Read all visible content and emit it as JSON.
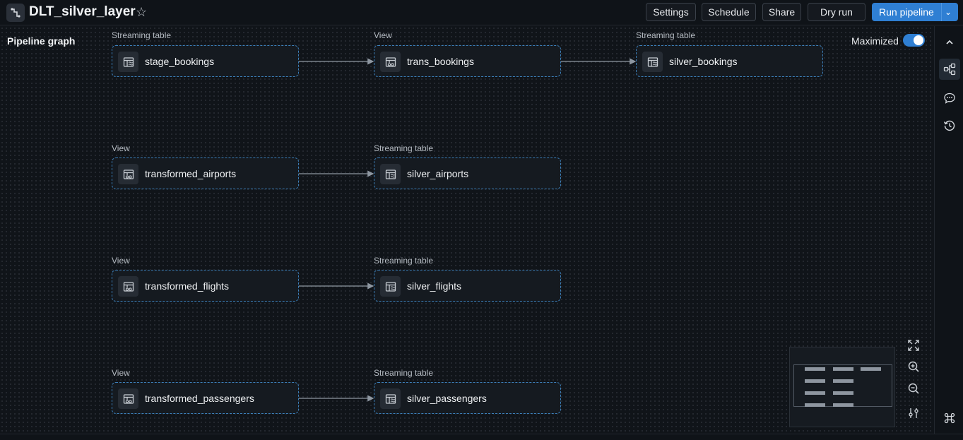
{
  "header": {
    "title": "DLT_silver_layer",
    "buttons": {
      "settings": "Settings",
      "schedule": "Schedule",
      "share": "Share",
      "dry_run": "Dry run",
      "run_pipeline": "Run pipeline"
    }
  },
  "graph": {
    "title": "Pipeline graph",
    "maximized_label": "Maximized",
    "maximized": true,
    "nodes": {
      "stage_bookings": {
        "type": "Streaming table",
        "name": "stage_bookings"
      },
      "trans_bookings": {
        "type": "View",
        "name": "trans_bookings"
      },
      "silver_bookings": {
        "type": "Streaming table",
        "name": "silver_bookings"
      },
      "transformed_airports": {
        "type": "View",
        "name": "transformed_airports"
      },
      "silver_airports": {
        "type": "Streaming table",
        "name": "silver_airports"
      },
      "transformed_flights": {
        "type": "View",
        "name": "transformed_flights"
      },
      "silver_flights": {
        "type": "Streaming table",
        "name": "silver_flights"
      },
      "transformed_passengers": {
        "type": "View",
        "name": "transformed_passengers"
      },
      "silver_passengers": {
        "type": "Streaming table",
        "name": "silver_passengers"
      }
    }
  },
  "icons": {
    "app": "pipeline-icon",
    "star": "star-icon",
    "streaming_table": "streaming-table-icon",
    "view": "view-icon",
    "rail": [
      "collapse-chevron-icon",
      "graph-icon",
      "comment-icon",
      "history-icon",
      "command-icon"
    ],
    "zoom": [
      "fit-view-icon",
      "zoom-in-icon",
      "zoom-out-icon",
      "settings-sliders-icon"
    ]
  },
  "colors": {
    "accent": "#2f7fd3",
    "node_border": "#3c7fb9",
    "background": "#101419"
  }
}
